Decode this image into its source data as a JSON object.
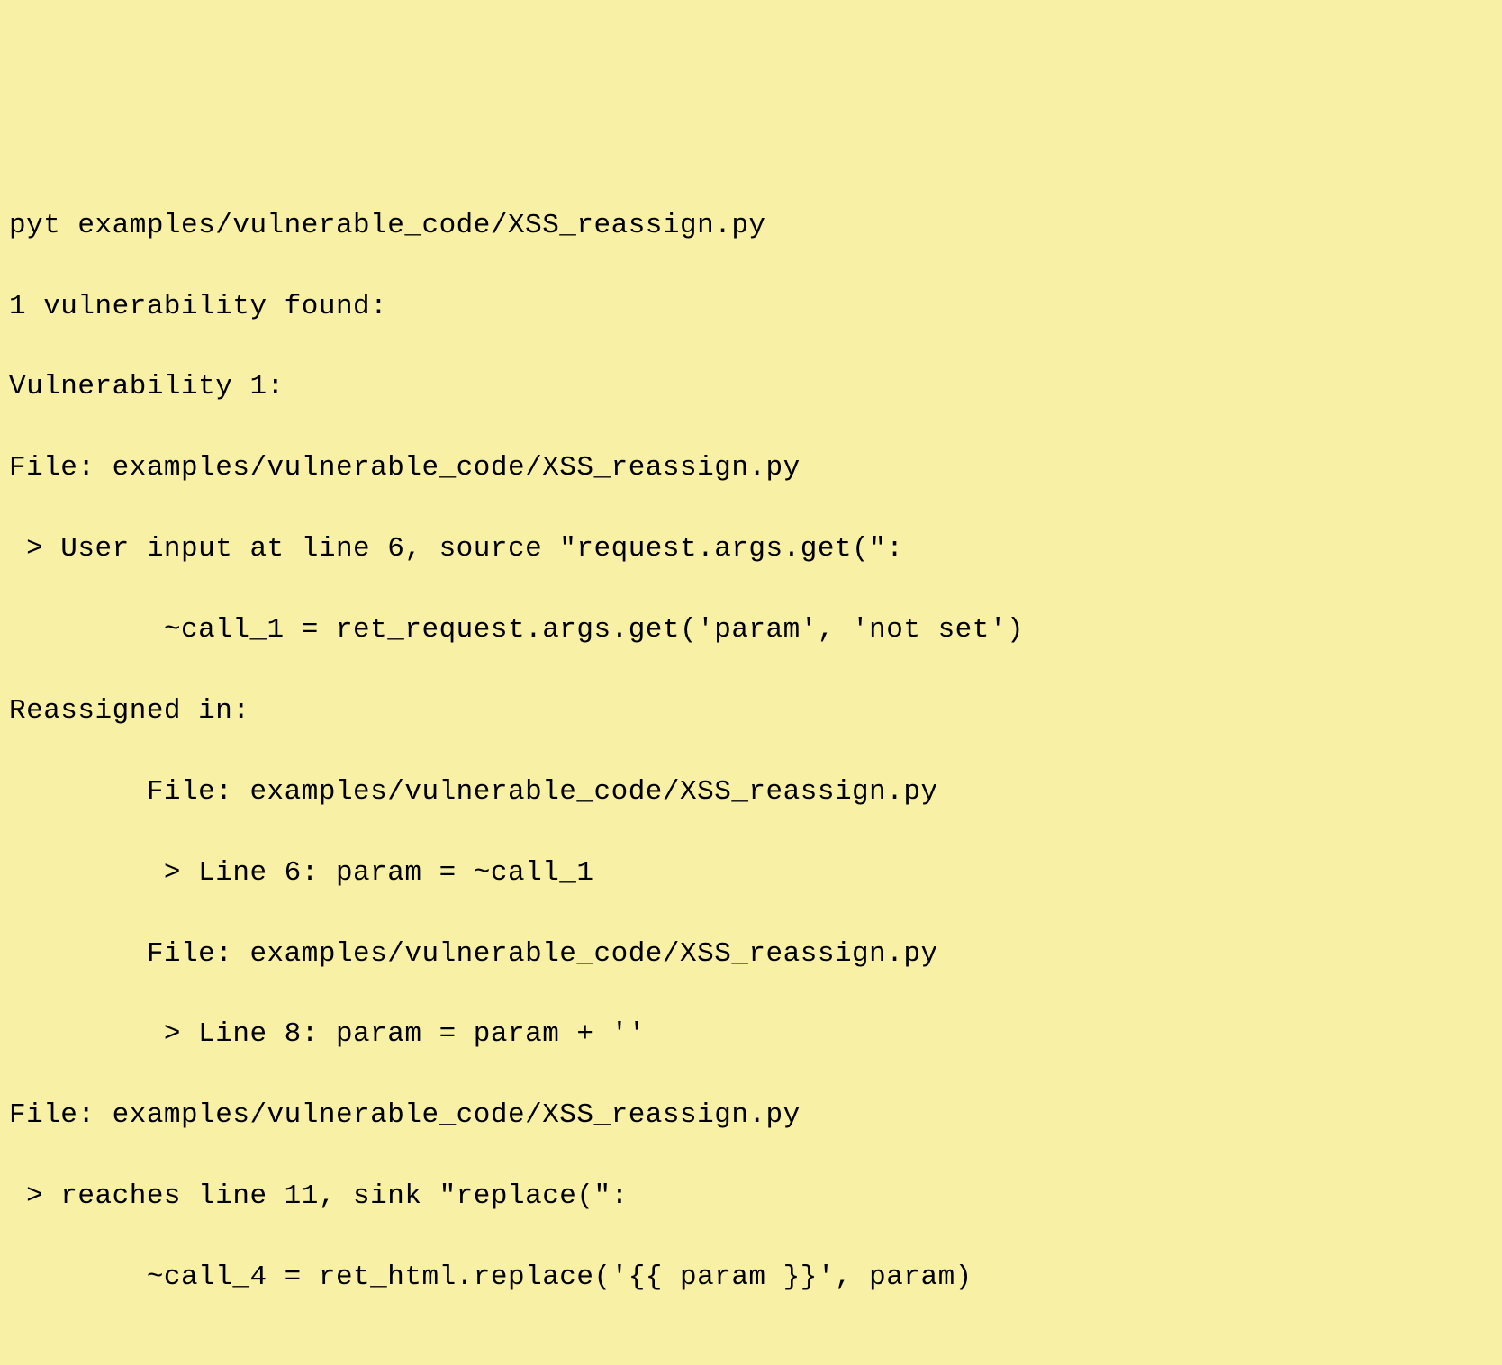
{
  "lines": [
    "pyt examples/vulnerable_code/XSS_reassign.py",
    "1 vulnerability found:",
    "Vulnerability 1:",
    "File: examples/vulnerable_code/XSS_reassign.py",
    " > User input at line 6, source \"request.args.get(\":",
    "         ~call_1 = ret_request.args.get('param', 'not set')",
    "Reassigned in:",
    "        File: examples/vulnerable_code/XSS_reassign.py",
    "         > Line 6: param = ~call_1",
    "        File: examples/vulnerable_code/XSS_reassign.py",
    "         > Line 8: param = param + ''",
    "File: examples/vulnerable_code/XSS_reassign.py",
    " > reaches line 11, sink \"replace(\":",
    "        ~call_4 = ret_html.replace('{{ param }}', param)"
  ]
}
